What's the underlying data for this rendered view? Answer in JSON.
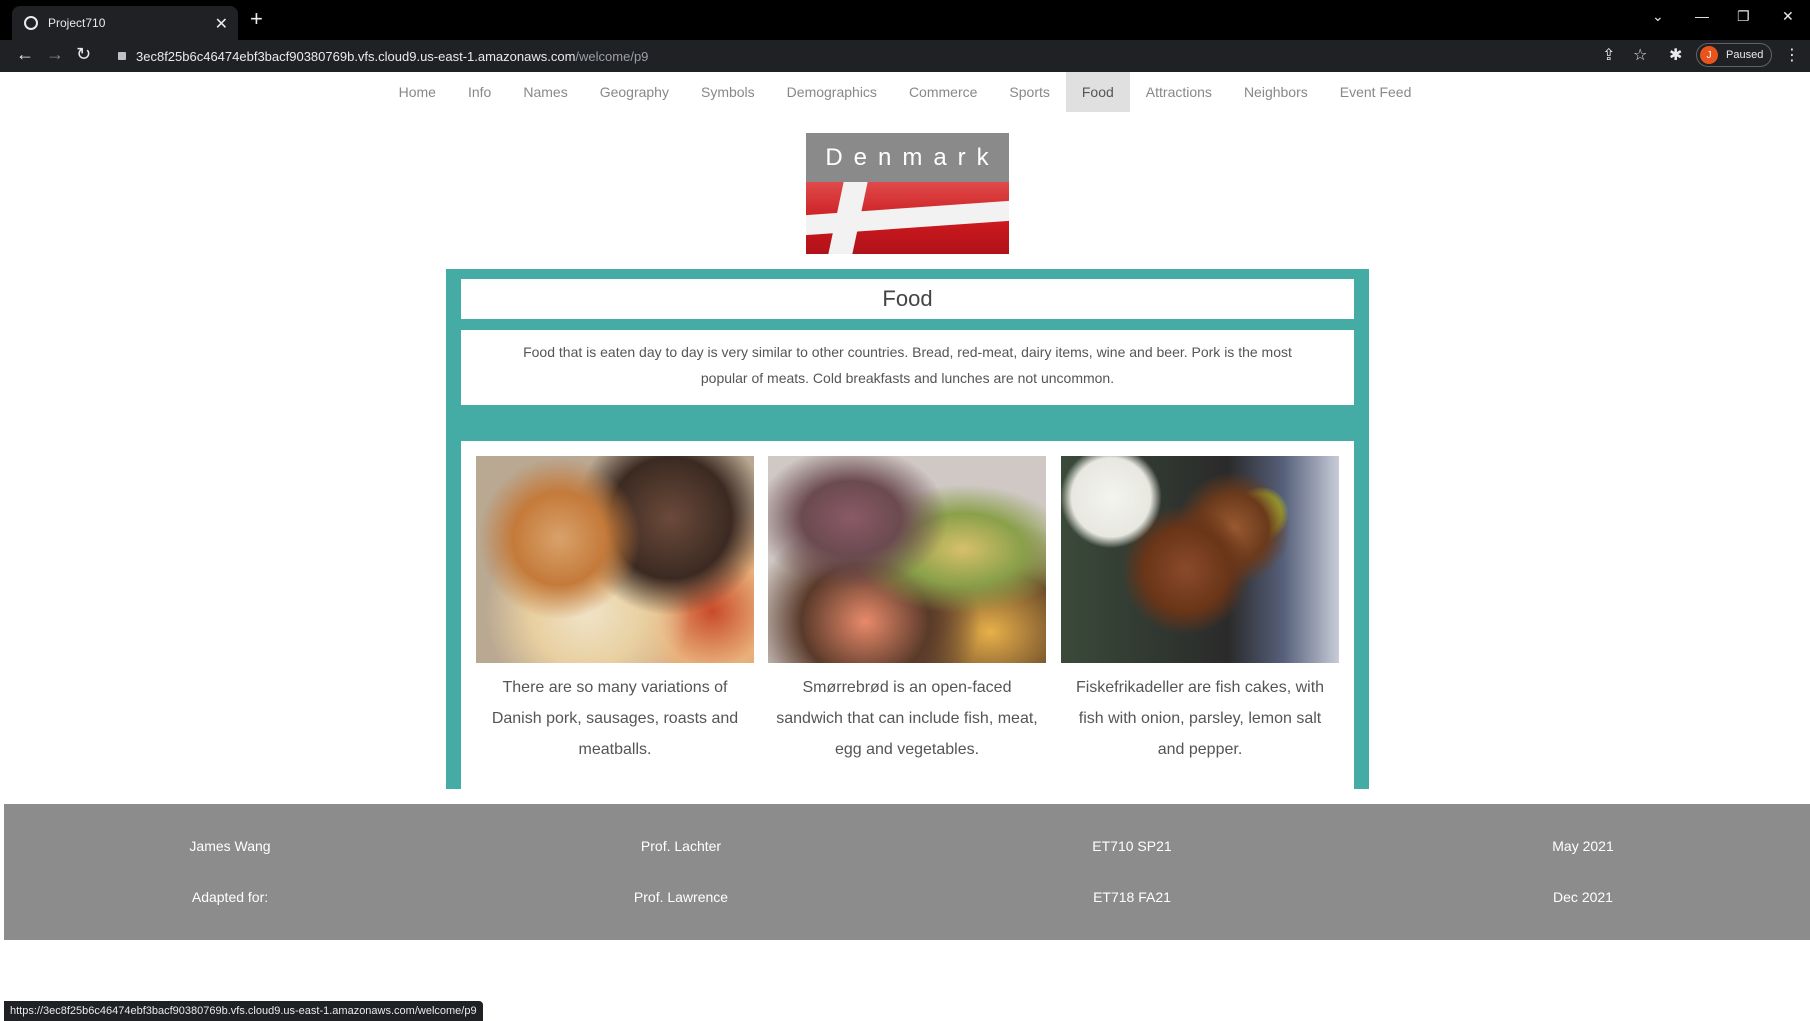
{
  "browser": {
    "tab_title": "Project710",
    "url_host": "3ec8f25b6c46474ebf3bacf90380769b.vfs.cloud9.us-east-1.amazonaws.com",
    "url_path": "/welcome/p9",
    "profile_initial": "J",
    "profile_status": "Paused",
    "status_url": "https://3ec8f25b6c46474ebf3bacf90380769b.vfs.cloud9.us-east-1.amazonaws.com/welcome/p9"
  },
  "nav": {
    "items": [
      "Home",
      "Info",
      "Names",
      "Geography",
      "Symbols",
      "Demographics",
      "Commerce",
      "Sports",
      "Food",
      "Attractions",
      "Neighbors",
      "Event Feed"
    ],
    "active": "Food"
  },
  "header": {
    "country": "Denmark"
  },
  "section": {
    "title": "Food",
    "description": "Food that is eaten day to day is very similar to other countries. Bread, red-meat, dairy items, wine and beer. Pork is the most popular of meats. Cold breakfasts and lunches are not uncommon.",
    "cards": [
      {
        "caption": "There are so many variations of Danish pork, sausages, roasts and meatballs."
      },
      {
        "caption": "Smørrebrød is an open-faced sandwich that can include fish, meat, egg and vegetables."
      },
      {
        "caption": "Fiskefrikadeller are fish cakes, with fish with onion, parsley, lemon salt and pepper."
      }
    ]
  },
  "footer": {
    "col1": [
      "James Wang",
      "Adapted for:"
    ],
    "col2": [
      "Prof. Lachter",
      "Prof. Lawrence"
    ],
    "col3": [
      "ET710 SP21",
      "ET718 FA21"
    ],
    "col4": [
      "May 2021",
      "Dec 2021"
    ]
  }
}
